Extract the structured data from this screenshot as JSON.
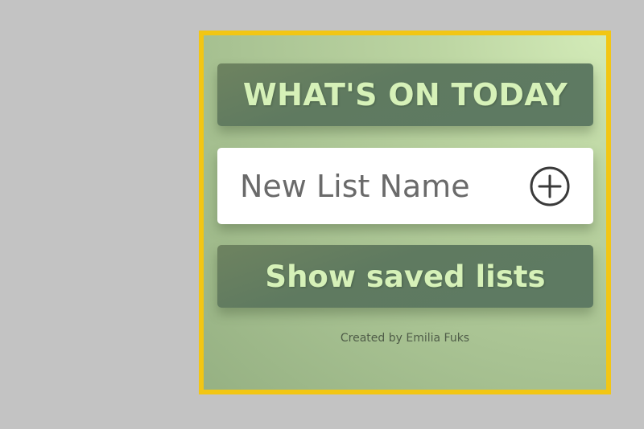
{
  "header": {
    "title": "WHAT'S ON TODAY"
  },
  "new_list": {
    "placeholder": "New List Name",
    "value": "",
    "add_icon": "plus-circle-icon"
  },
  "saved_lists": {
    "button_label": "Show saved lists"
  },
  "footer": {
    "credit": "Created by Emilia Fuks"
  },
  "colors": {
    "frame_border": "#f2c614",
    "panel_green": "#5f7a60",
    "title_text": "#d6f1b8",
    "page_background": "#c3c3c3"
  }
}
